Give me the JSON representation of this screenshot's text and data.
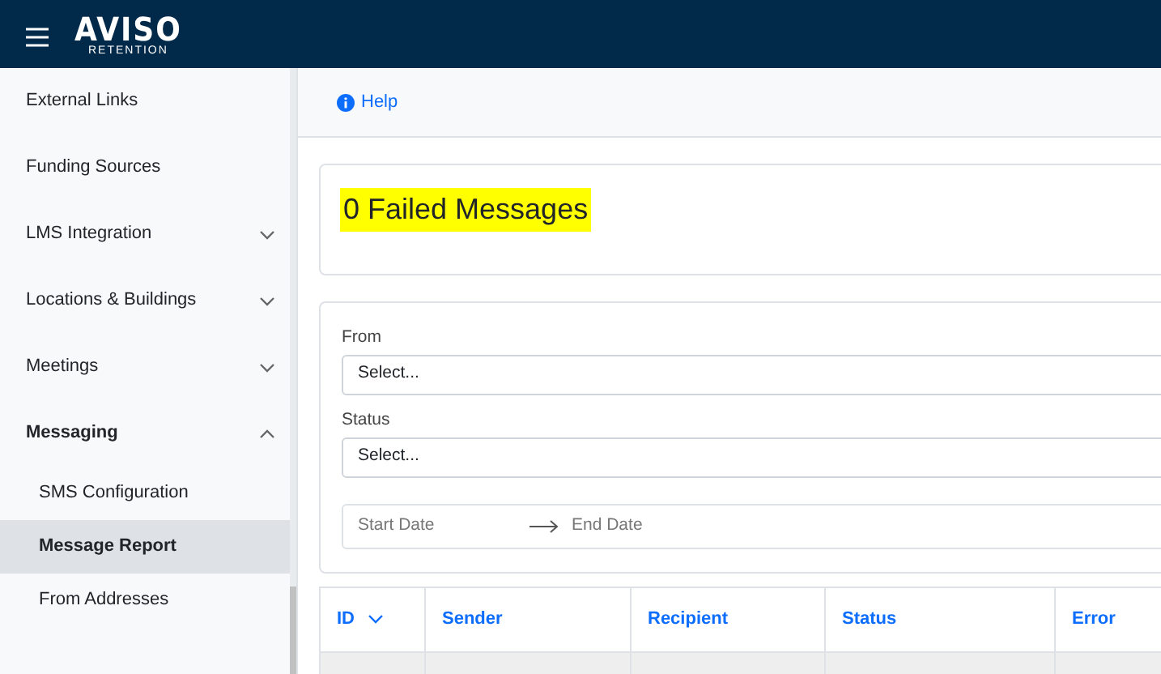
{
  "header": {
    "logo_title": "AVISO",
    "logo_subtitle": "RETENTION"
  },
  "sidebar": {
    "items": [
      {
        "label": "External Links",
        "expandable": false,
        "expanded": false
      },
      {
        "label": "Funding Sources",
        "expandable": false,
        "expanded": false
      },
      {
        "label": "LMS Integration",
        "expandable": true,
        "expanded": false
      },
      {
        "label": "Locations & Buildings",
        "expandable": true,
        "expanded": false
      },
      {
        "label": "Meetings",
        "expandable": true,
        "expanded": false
      },
      {
        "label": "Messaging",
        "expandable": true,
        "expanded": true,
        "children": [
          {
            "label": "SMS Configuration",
            "selected": false
          },
          {
            "label": "Message Report",
            "selected": true
          },
          {
            "label": "From Addresses",
            "selected": false
          }
        ]
      }
    ]
  },
  "toolbar": {
    "help_link": "Help"
  },
  "summary": {
    "title": "0 Failed Messages"
  },
  "filters": {
    "fields": [
      {
        "label": "From",
        "placeholder": "Select..."
      },
      {
        "label": "Status",
        "placeholder": "Select..."
      }
    ],
    "date_range": {
      "start_placeholder": "Start Date",
      "end_placeholder": "End Date"
    }
  },
  "table": {
    "columns": [
      {
        "label": "ID",
        "sorted": true
      },
      {
        "label": "Sender",
        "sorted": false
      },
      {
        "label": "Recipient",
        "sorted": false
      },
      {
        "label": "Status",
        "sorted": false
      },
      {
        "label": "Error",
        "sorted": false
      }
    ]
  }
}
